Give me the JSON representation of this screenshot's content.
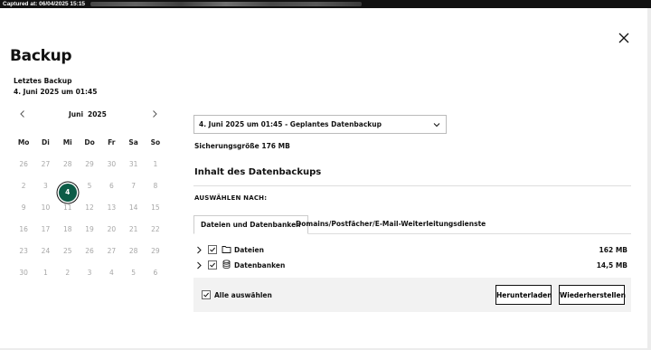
{
  "capture_bar": {
    "text": "Captured at: 06/04/2025 15:15"
  },
  "dialog": {
    "title": "Backup",
    "last_backup_label": "Letztes Backup",
    "last_backup_value": "4. Juni 2025 um 01:45"
  },
  "calendar": {
    "month": "Juni",
    "year": "2025",
    "weekdays": [
      "Mo",
      "Di",
      "Mi",
      "Do",
      "Fr",
      "Sa",
      "So"
    ],
    "weeks": [
      [
        "26",
        "27",
        "28",
        "29",
        "30",
        "31",
        "1"
      ],
      [
        "2",
        "3",
        "4",
        "5",
        "6",
        "7",
        "8"
      ],
      [
        "9",
        "10",
        "11",
        "12",
        "13",
        "14",
        "15"
      ],
      [
        "16",
        "17",
        "18",
        "19",
        "20",
        "21",
        "22"
      ],
      [
        "23",
        "24",
        "25",
        "26",
        "27",
        "28",
        "29"
      ],
      [
        "30",
        "1",
        "2",
        "3",
        "4",
        "5",
        "6"
      ]
    ],
    "selected_day": "4"
  },
  "backup_select": {
    "value": "4. Juni 2025 um 01:45 - Geplantes Datenbackup"
  },
  "backup_size": "Sicherungsgröße 176 MB",
  "contents": {
    "title": "Inhalt des Datenbackups",
    "select_by": "AUSWÄHLEN NACH:",
    "tabs": [
      {
        "label": "Dateien und Datenbanken"
      },
      {
        "label": "Domains/Postfächer/E-Mail-Weiterleitungsdienste"
      }
    ],
    "items": [
      {
        "label": "Dateien",
        "size": "162 MB",
        "icon": "folder-icon"
      },
      {
        "label": "Datenbanken",
        "size": "14,5 MB",
        "icon": "database-icon"
      }
    ],
    "select_all": "Alle auswählen",
    "download_label": "Herunterladen",
    "restore_label": "Wiederherstellen"
  },
  "colors": {
    "accent": "#0c5c47",
    "available_day": "#9fcfc8",
    "muted_day": "#a7a7a7"
  }
}
